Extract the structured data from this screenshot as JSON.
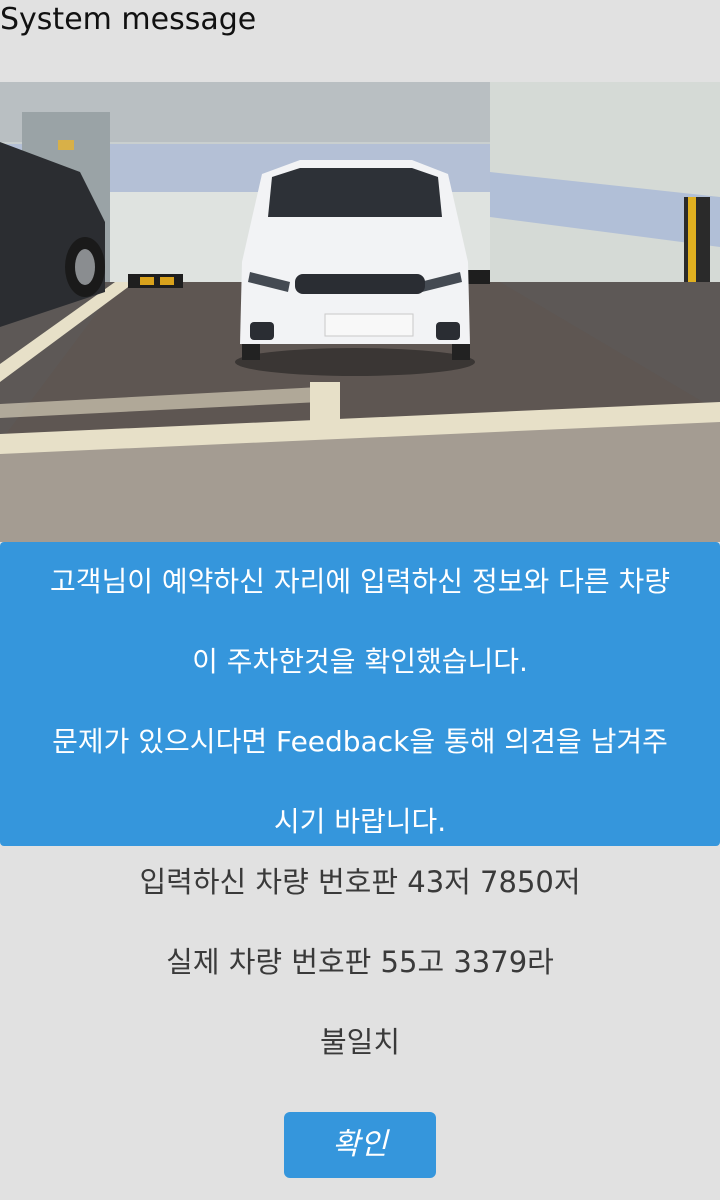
{
  "dialog": {
    "title": "System message",
    "message_lines": [
      "고객님이 예약하신 자리에 입력하신 정보와 다른 차량",
      "이 주차한것을 확인했습니다.",
      "문제가 있으시다면 Feedback을 통해 의견을 남겨주",
      "시기 바랍니다."
    ],
    "entered_plate": "입력하신 차량 번호판 43저 7850저",
    "actual_plate": "실제 차량 번호판 55고 3379라",
    "result": "불일치",
    "confirm_label": "확인"
  },
  "colors": {
    "background": "#e1e1e1",
    "accent": "#3596dc"
  }
}
